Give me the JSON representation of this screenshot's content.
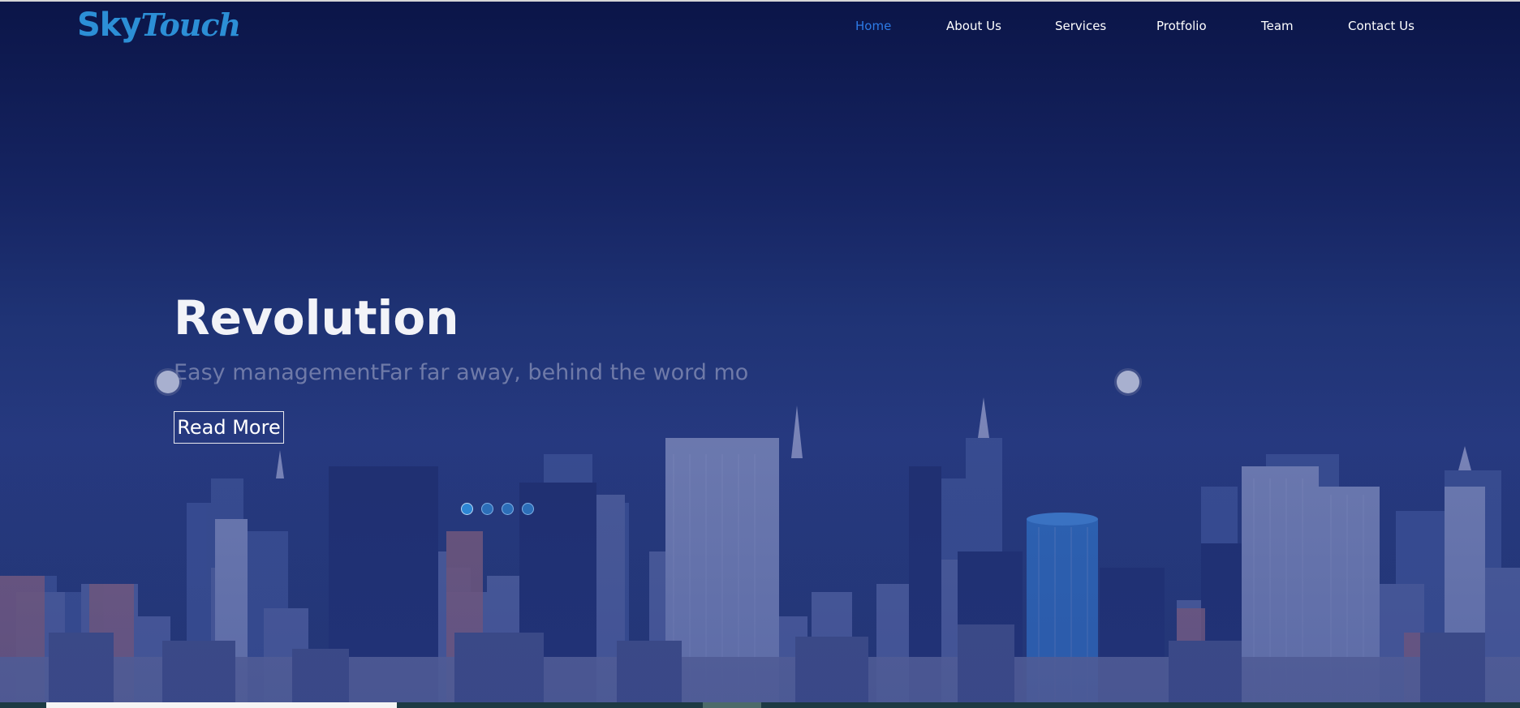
{
  "brand": {
    "logo_part1": "Sky",
    "logo_part2": "Touch",
    "logo_color": "#2c8fd6"
  },
  "nav": {
    "items": [
      {
        "label": "Home",
        "active": true
      },
      {
        "label": "About Us",
        "active": false
      },
      {
        "label": "Services",
        "active": false
      },
      {
        "label": "Protfolio",
        "active": false
      },
      {
        "label": "Team",
        "active": false
      },
      {
        "label": "Contact Us",
        "active": false
      }
    ],
    "active_color": "#2d7be6"
  },
  "hero": {
    "title": "Revolution",
    "subtitle": "Easy managementFar far away, behind the word mo",
    "button_label": "Read More",
    "slides_total": 4,
    "active_slide": 1
  },
  "icons": {
    "prev": "prev-arrow-icon",
    "next": "next-arrow-icon"
  }
}
